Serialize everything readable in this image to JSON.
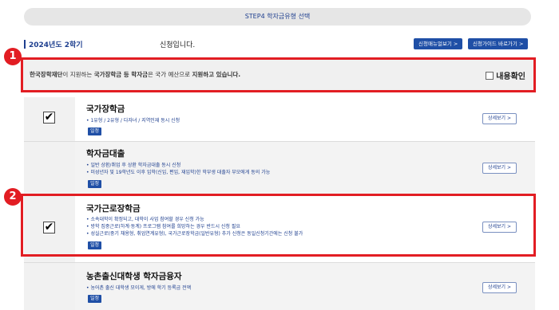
{
  "step_bar": {
    "label": "STEP4 학자금유형 선택"
  },
  "header": {
    "term": "2024년도 2학기",
    "apply_text": "신청입니다.",
    "manual_button": "신청매뉴얼보기 >",
    "guide_button": "신청가이드 바로가기 >"
  },
  "markers": {
    "m1": "1",
    "m2": "2"
  },
  "notice": {
    "part1": "한국장학재단",
    "part2": "이 지원하는 ",
    "part3": "국가장학금 등 학자금",
    "part4": "은 국가 예산으로 ",
    "part5": "지원하고 있습니다.",
    "confirm_label": "내용확인"
  },
  "items": [
    {
      "title": "국가장학금",
      "desc": [
        "• 1유형 / 2유형 / 다자녀 / 지역인재 동시 신청"
      ],
      "badge": "일정",
      "detail": "상세보기 >",
      "check_mark": "✔"
    },
    {
      "title": "학자금대출",
      "desc": [
        "• 일반 상환/취업 후 상환 학자금대출 동시 신청",
        "• 미성년자 및 19학년도 이후 입학(신입, 편입, 재입학)한 학부생 대출자 부모에게 동의 가능"
      ],
      "badge": "일정",
      "detail": "상세보기 >"
    },
    {
      "title": "국가근로장학금",
      "desc": [
        "• 소속대학이 확정되고, 대학이 사업 참여할 경우 신청 가능",
        "• 방학 집중근로(하계·동계) 프로그램 참여를 희망하는 경우 반드시 신청 필요",
        "• 성실근로(중기 채용형, 취업연계유형), 국가근로장학금(일반유형) 추가 신청은 동일신청기간에는 신청 불가"
      ],
      "badge": "일정",
      "detail": "상세보기 >",
      "check_mark": "✔"
    },
    {
      "title": "농촌출신대학생 학자금융자",
      "desc": [
        "• 농어촌 출신 대학생 모이게, 방에 학기 등록금 전액"
      ],
      "badge": "일정",
      "detail": "상세보기 >"
    }
  ],
  "colors": {
    "accent": "#1f4fa6",
    "highlight": "#e21d23"
  }
}
